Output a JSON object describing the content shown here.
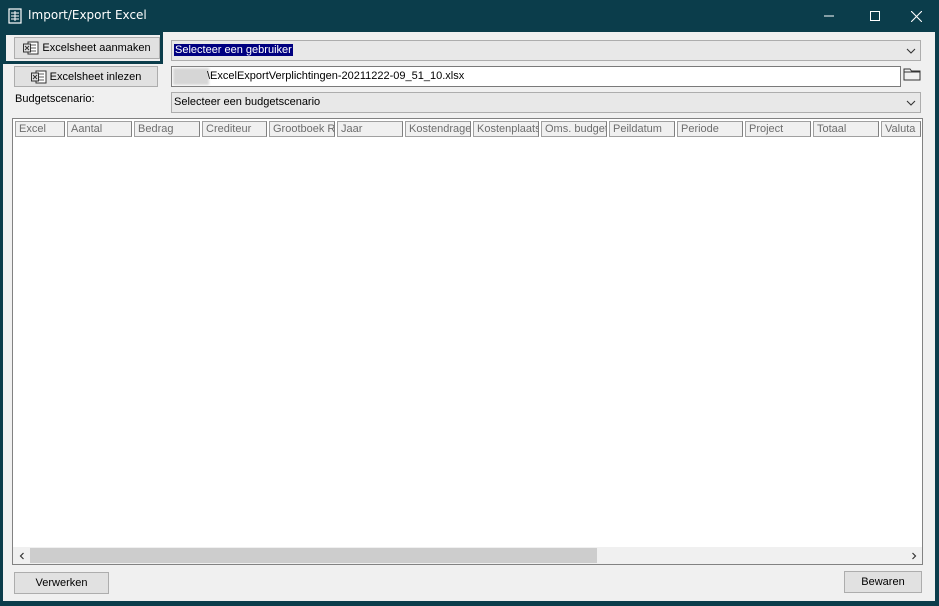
{
  "window": {
    "title": "Import/Export Excel"
  },
  "toolbar": {
    "create_label": "Excelsheet aanmaken",
    "import_label": "Excelsheet inlezen"
  },
  "user_select": {
    "selected": "Selecteer een gebruiker"
  },
  "file_path": {
    "value": "\\ExcelExportVerplichtingen-20211222-09_51_10.xlsx"
  },
  "budget": {
    "label": "Budgetscenario:",
    "selected": "Selecteer een budgetscenario"
  },
  "grid": {
    "columns": [
      "Excel",
      "Aantal",
      "Bedrag",
      "Crediteur",
      "Grootboek Re",
      "Jaar",
      "Kostendrage",
      "Kostenplaats",
      "Oms. budget",
      "Peildatum",
      "Periode",
      "Project",
      "Totaal",
      "Valuta"
    ]
  },
  "footer": {
    "process_label": "Verwerken",
    "save_label": "Bewaren"
  },
  "icons": {
    "app": "spreadsheet-icon",
    "excel": "excel-icon",
    "folder": "folder-icon",
    "dropdown": "chevron-down-icon"
  },
  "colors": {
    "titlebar": "#0b3d4b",
    "selection": "#000080",
    "window_bg": "#f0f0f0"
  }
}
